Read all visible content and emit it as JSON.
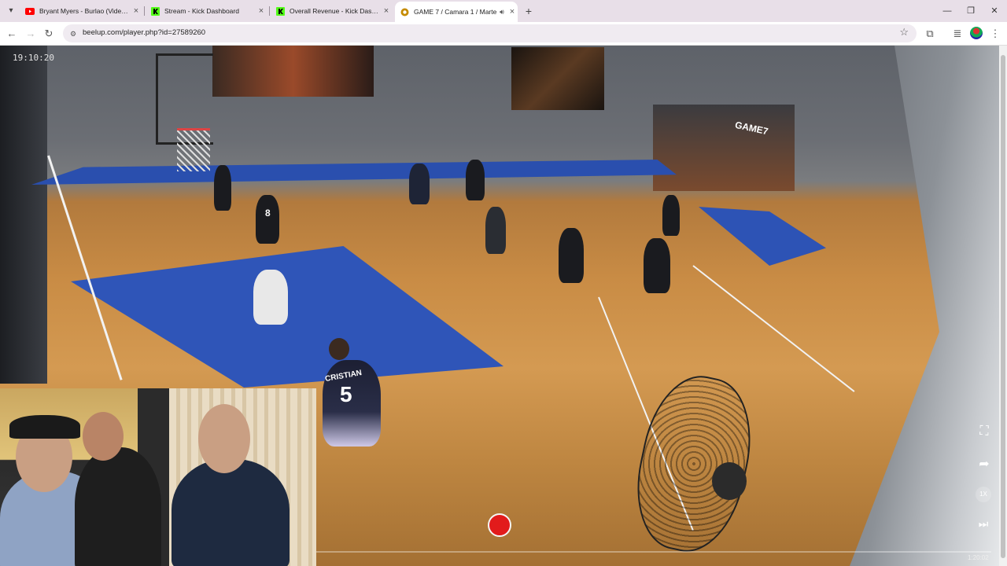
{
  "browser": {
    "tabs": [
      {
        "label": "Bryant Myers - Burlao (Video O",
        "icon": "youtube-icon",
        "color": "#ff0000"
      },
      {
        "label": "Stream - Kick Dashboard",
        "icon": "kick-icon",
        "color": "#53fc18"
      },
      {
        "label": "Overall Revenue - Kick Dashbo",
        "icon": "kick-icon",
        "color": "#53fc18"
      },
      {
        "label": "GAME 7 / Camara 1 / Marte",
        "icon": "beelup-icon",
        "color": "#c58b00"
      }
    ],
    "url": "beelup.com/player.php?id=27589260"
  },
  "player": {
    "timestamp": "19:10:20",
    "duration": "1:20:02",
    "speed": "1X",
    "progress": 0.0
  },
  "scene": {
    "jersey_name": "CRISTIAN",
    "jersey_number": "5",
    "player_number": "8",
    "gym_logo": "GAME7"
  }
}
